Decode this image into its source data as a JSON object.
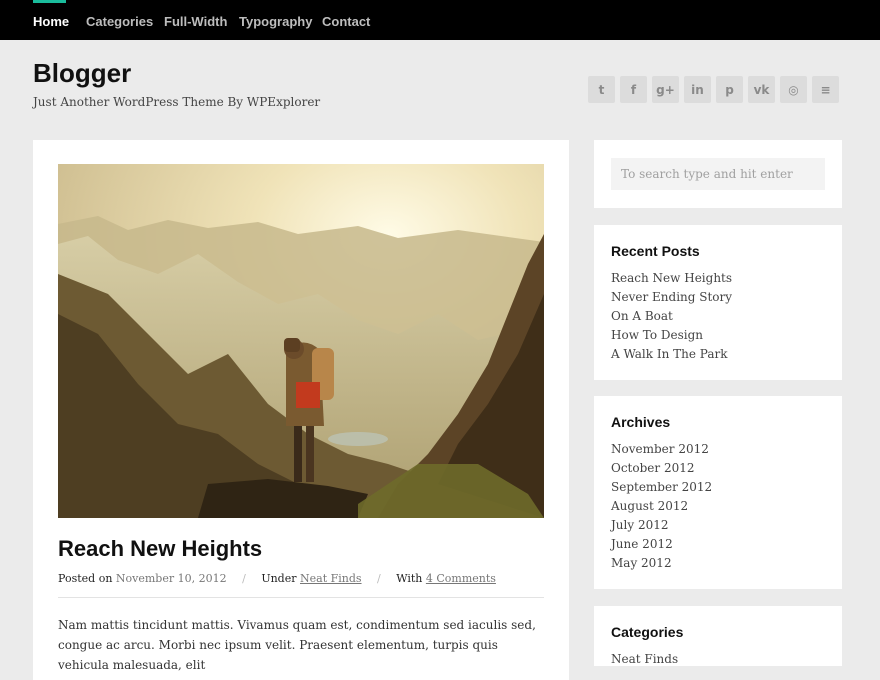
{
  "nav": {
    "items": [
      {
        "label": "Home"
      },
      {
        "label": "Categories"
      },
      {
        "label": "Full-Width"
      },
      {
        "label": "Typography"
      },
      {
        "label": "Contact"
      }
    ],
    "active": "Home",
    "accent_color": "#1abc9c"
  },
  "header": {
    "title": "Blogger",
    "tagline": "Just Another WordPress Theme By WPExplorer"
  },
  "social": {
    "icons": [
      "twitter-icon",
      "facebook-icon",
      "google-plus-icon",
      "linkedin-icon",
      "pinterest-icon",
      "vk-icon",
      "instagram-icon",
      "rss-icon"
    ],
    "glyphs": [
      "t",
      "f",
      "g+",
      "in",
      "p",
      "vk",
      "◎",
      "≡"
    ]
  },
  "post": {
    "title": "Reach New Heights",
    "posted_label": "Posted on",
    "date": "November 10, 2012",
    "under_label": "Under",
    "category": "Neat Finds",
    "with_label": "With",
    "comments": "4 Comments",
    "excerpt": "Nam mattis tincidunt mattis. Vivamus quam est, condimentum sed iaculis sed, congue ac arcu. Morbi nec ipsum velit. Praesent elementum, turpis quis vehicula malesuada, elit"
  },
  "search": {
    "placeholder": "To search type and hit enter"
  },
  "recent_posts": {
    "title": "Recent Posts",
    "items": [
      "Reach New Heights",
      "Never Ending Story",
      "On A Boat",
      "How To Design",
      "A Walk In The Park"
    ]
  },
  "archives": {
    "title": "Archives",
    "items": [
      "November 2012",
      "October 2012",
      "September 2012",
      "August 2012",
      "July 2012",
      "June 2012",
      "May 2012"
    ]
  },
  "categories_widget": {
    "title": "Categories",
    "items": [
      "Neat Finds"
    ]
  }
}
